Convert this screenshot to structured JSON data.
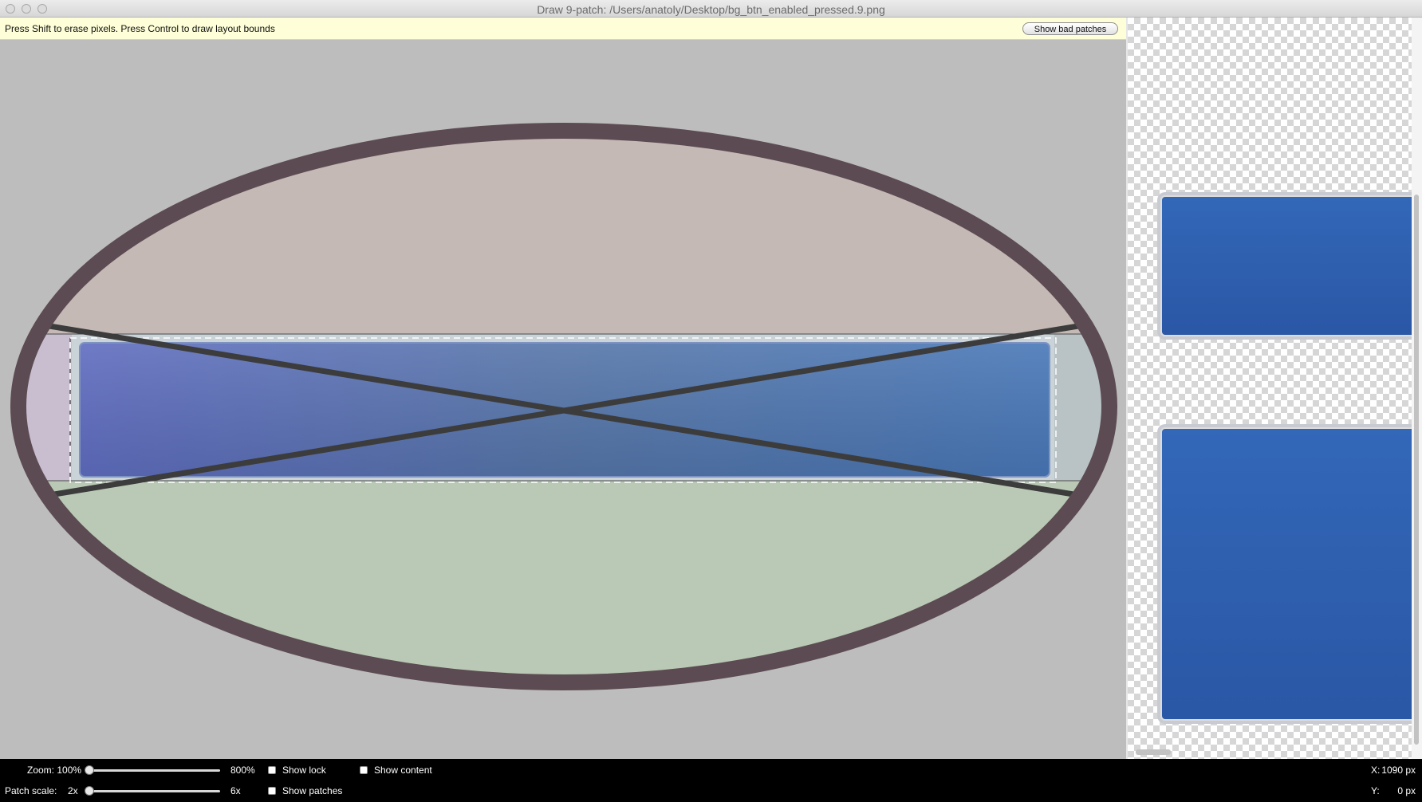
{
  "window": {
    "title": "Draw 9-patch: /Users/anatoly/Desktop/bg_btn_enabled_pressed.9.png"
  },
  "infobar": {
    "hint": "Press Shift to erase pixels. Press Control to draw layout bounds",
    "bad_patches_label": "Show bad patches"
  },
  "controls": {
    "zoom_label": "Zoom: 100%",
    "zoom_max": "800%",
    "zoom_value_percent": 100,
    "patch_scale_label": "Patch scale:",
    "patch_scale_min": "2x",
    "patch_scale_max": "6x",
    "patch_scale_value": 2,
    "show_lock": "Show lock",
    "show_patches": "Show patches",
    "show_content": "Show content",
    "show_lock_checked": false,
    "show_patches_checked": false,
    "show_content_checked": false
  },
  "coords": {
    "x_label": "X:",
    "x_value": "1090 px",
    "y_label": "Y:",
    "y_value": "0 px"
  },
  "colors": {
    "ring": "#5c4b52",
    "top_region": "#c4b9b5",
    "bottom_region": "#bac9b5",
    "left_region": "#c8bed0",
    "right_region": "#b9c3c5",
    "button_left": "#5f6fbd",
    "button_right": "#4a7ab5",
    "preview_blue": "#2f5fb0"
  },
  "icons": {
    "close": "traffic-light-close-icon",
    "minimize": "traffic-light-minimize-icon",
    "zoom": "traffic-light-zoom-icon"
  }
}
